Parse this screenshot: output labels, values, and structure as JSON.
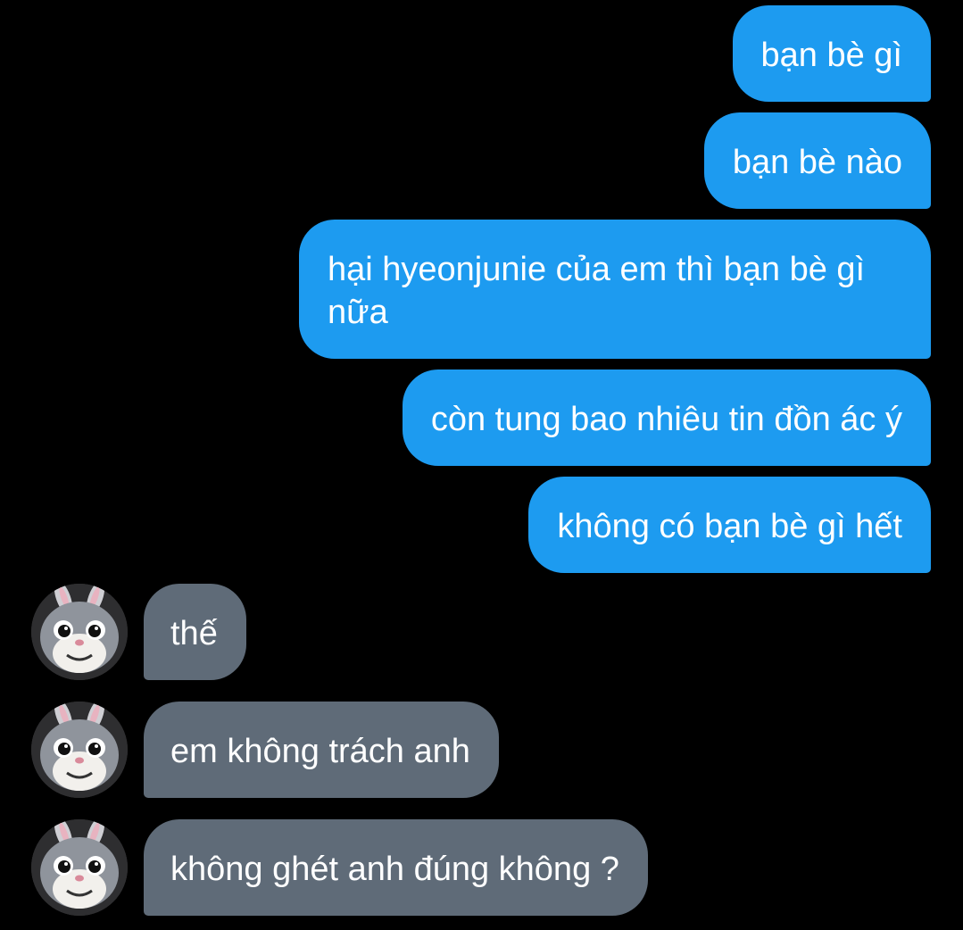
{
  "conversation": {
    "sent": [
      "bạn bè gì",
      "bạn bè nào",
      "hại hyeonjunie của em thì bạn bè gì nữa",
      "còn tung bao nhiêu tin đồn ác ý",
      "không có bạn bè gì hết"
    ],
    "received": [
      "thế",
      "em không trách anh",
      "không ghét anh đúng không ?"
    ],
    "avatar_icon": "bunny-mascot-avatar",
    "colors": {
      "background": "#000000",
      "sent_bubble": "#1d9bf0",
      "received_bubble": "#5f6b78",
      "text": "#ffffff"
    }
  }
}
